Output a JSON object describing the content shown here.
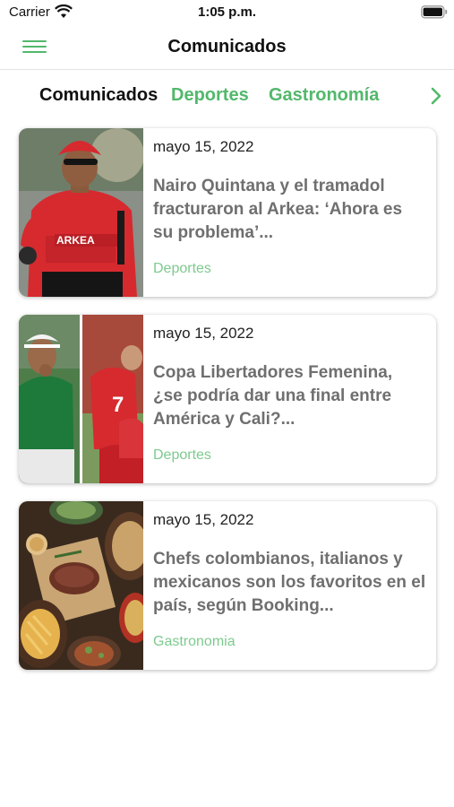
{
  "status_bar": {
    "carrier": "Carrier",
    "time": "1:05 p.m.",
    "wifi_icon": "wifi-icon",
    "battery_icon": "battery-icon"
  },
  "nav": {
    "title": "Comunicados",
    "menu_icon": "hamburger-menu-icon"
  },
  "tabs": [
    {
      "label": "Comunicados",
      "active": true
    },
    {
      "label": "Deportes",
      "active": false
    },
    {
      "label": "Gastronomía",
      "active": false
    }
  ],
  "tabs_next_icon": "chevron-right-icon",
  "articles": [
    {
      "date": "mayo 15, 2022",
      "title": "Nairo Quintana y el tramadol fracturaron al Arkea: ‘Ahora es su problema’...",
      "category": "Deportes",
      "image_text": "ARKEA"
    },
    {
      "date": "mayo 15, 2022",
      "title": "Copa Libertadores Femenina, ¿se podría dar una final entre América y Cali?...",
      "category": "Deportes",
      "image_text": "7"
    },
    {
      "date": "mayo 15, 2022",
      "title": "Chefs colombianos, italianos y mexicanos son los favoritos en el país, según Booking...",
      "category": "Gastronomia"
    }
  ],
  "colors": {
    "accent": "#52b86b",
    "category_text": "#7dca8e",
    "title_text": "#6f6f6f"
  }
}
